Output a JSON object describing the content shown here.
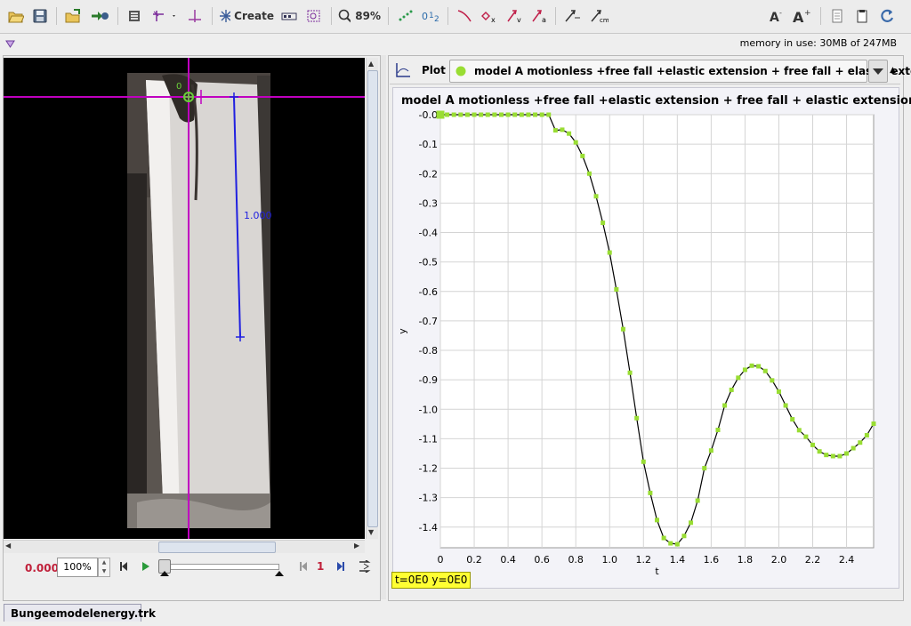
{
  "toolbar": {
    "create_label": "Create",
    "zoom_label": "89%"
  },
  "memory": {
    "text": "memory in use: 30MB of 247MB"
  },
  "video": {
    "calibration_label": "1.000",
    "axis_origin_label": "0"
  },
  "player": {
    "time": "0.000",
    "zoom": "100%",
    "step": "1"
  },
  "plot": {
    "tab_label": "Plot",
    "track_name": "model A motionless +free fall +elastic extension + free fall + elastic extension",
    "title": "model A motionless +free fall +elastic extension + free fall + elastic extension (t,",
    "readout": "t=0E0  y=0E0",
    "marker_color": "#99dd33",
    "curve_color": "#000000"
  },
  "chart_data": {
    "type": "scatter",
    "title": "model A motionless +free fall +elastic extension + free fall + elastic extension (t,",
    "xlabel": "t",
    "ylabel": "y",
    "xlim": [
      0,
      2.56
    ],
    "ylim": [
      -1.47,
      0.0
    ],
    "x_ticks": [
      "0",
      "0.2",
      "0.4",
      "0.6",
      "0.8",
      "1.0",
      "1.2",
      "1.4",
      "1.6",
      "1.8",
      "2.0",
      "2.2",
      "2.4"
    ],
    "y_ticks": [
      "-0.0",
      "-0.1",
      "-0.2",
      "-0.3",
      "-0.4",
      "-0.5",
      "-0.6",
      "-0.7",
      "-0.8",
      "-0.9",
      "-1.0",
      "-1.1",
      "-1.2",
      "-1.3",
      "-1.4"
    ],
    "grid": true,
    "series": [
      {
        "points": [
          [
            0.0,
            0.0
          ],
          [
            0.04,
            0.0
          ],
          [
            0.08,
            0.0
          ],
          [
            0.12,
            0.0
          ],
          [
            0.16,
            0.0
          ],
          [
            0.2,
            0.0
          ],
          [
            0.24,
            0.0
          ],
          [
            0.28,
            0.0
          ],
          [
            0.32,
            0.0
          ],
          [
            0.36,
            0.0
          ],
          [
            0.4,
            0.0
          ],
          [
            0.44,
            0.0
          ],
          [
            0.48,
            0.0
          ],
          [
            0.52,
            0.0
          ],
          [
            0.56,
            0.0
          ],
          [
            0.6,
            0.0
          ],
          [
            0.64,
            0.0
          ],
          [
            0.68,
            -0.053
          ],
          [
            0.72,
            -0.051
          ],
          [
            0.76,
            -0.064
          ],
          [
            0.8,
            -0.094
          ],
          [
            0.84,
            -0.14
          ],
          [
            0.88,
            -0.2
          ],
          [
            0.92,
            -0.277
          ],
          [
            0.96,
            -0.367
          ],
          [
            1.0,
            -0.468
          ],
          [
            1.04,
            -0.593
          ],
          [
            1.08,
            -0.728
          ],
          [
            1.12,
            -0.876
          ],
          [
            1.16,
            -1.03
          ],
          [
            1.2,
            -1.178
          ],
          [
            1.24,
            -1.284
          ],
          [
            1.28,
            -1.376
          ],
          [
            1.32,
            -1.437
          ],
          [
            1.36,
            -1.455
          ],
          [
            1.4,
            -1.458
          ],
          [
            1.44,
            -1.43
          ],
          [
            1.48,
            -1.385
          ],
          [
            1.52,
            -1.31
          ],
          [
            1.56,
            -1.2
          ],
          [
            1.6,
            -1.14
          ],
          [
            1.64,
            -1.07
          ],
          [
            1.68,
            -0.987
          ],
          [
            1.72,
            -0.934
          ],
          [
            1.76,
            -0.893
          ],
          [
            1.8,
            -0.866
          ],
          [
            1.84,
            -0.852
          ],
          [
            1.88,
            -0.854
          ],
          [
            1.92,
            -0.87
          ],
          [
            1.96,
            -0.902
          ],
          [
            2.0,
            -0.94
          ],
          [
            2.04,
            -0.987
          ],
          [
            2.08,
            -1.034
          ],
          [
            2.12,
            -1.071
          ],
          [
            2.16,
            -1.093
          ],
          [
            2.2,
            -1.121
          ],
          [
            2.24,
            -1.143
          ],
          [
            2.28,
            -1.155
          ],
          [
            2.32,
            -1.159
          ],
          [
            2.36,
            -1.159
          ],
          [
            2.4,
            -1.15
          ],
          [
            2.44,
            -1.132
          ],
          [
            2.48,
            -1.113
          ],
          [
            2.52,
            -1.088
          ],
          [
            2.56,
            -1.049
          ]
        ]
      }
    ]
  }
}
